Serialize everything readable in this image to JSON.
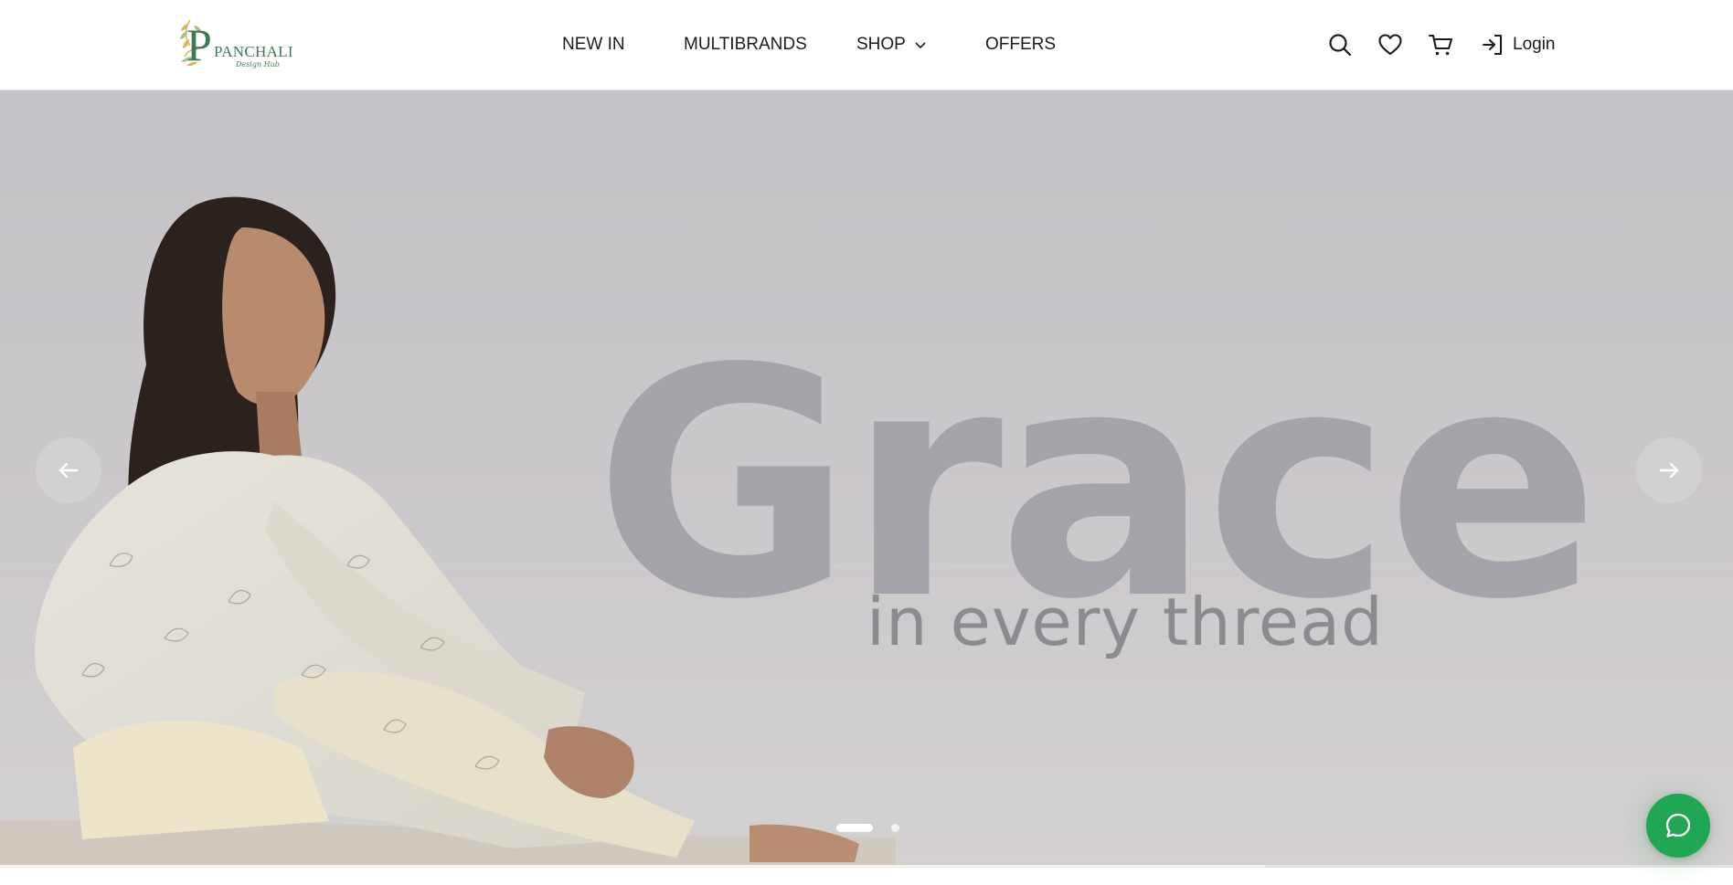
{
  "header": {
    "logo_text": "PANCHALI",
    "logo_tagline": "Design Hub",
    "nav": {
      "new_in": "NEW IN",
      "multibrands": "MULTIBRANDS",
      "shop": "SHOP",
      "offers": "OFFERS"
    },
    "icons": {
      "search": "search-icon",
      "wishlist": "heart-icon",
      "cart": "cart-icon",
      "login": "login-icon",
      "shop_dropdown": "chevron-down-icon"
    },
    "login_label": "Login"
  },
  "hero": {
    "headline": "Grace",
    "subline": "in every thread",
    "slide_count": 2,
    "active_slide": 1,
    "progress_fraction": 0.73,
    "prev_icon": "arrow-left-icon",
    "next_icon": "arrow-right-icon"
  },
  "chat": {
    "icon": "chat-bubble-icon"
  },
  "colors": {
    "brand_green": "#3f7a52",
    "chat_green": "#21a655",
    "headline_gray": "#a5a4aa"
  }
}
